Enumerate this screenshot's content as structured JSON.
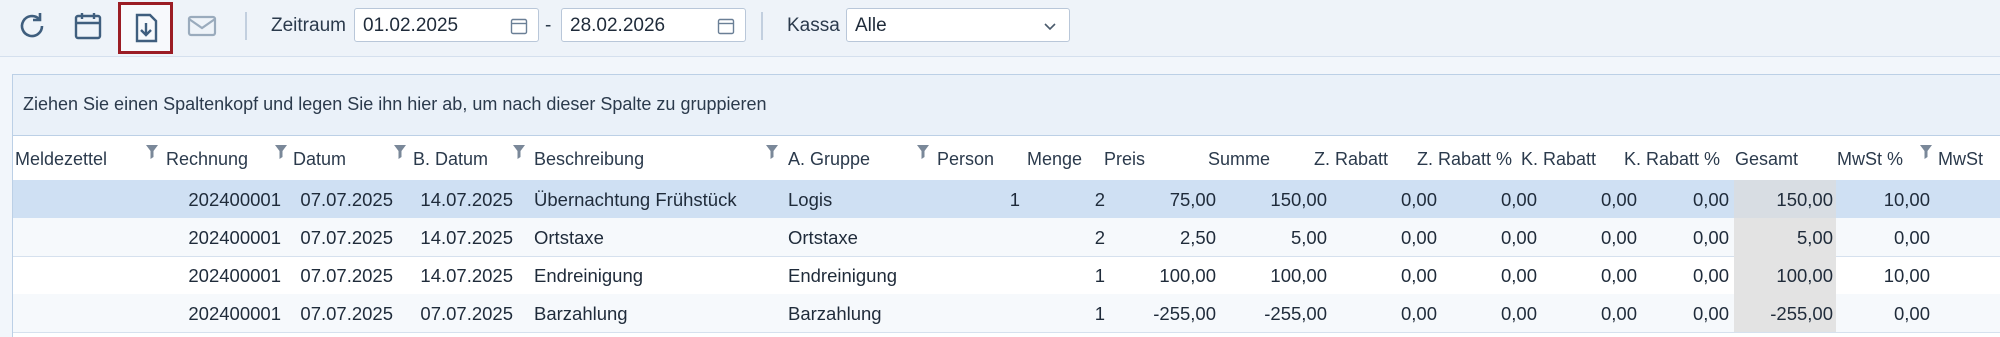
{
  "toolbar": {
    "zeitraum_label": "Zeitraum",
    "date_from": "01.02.2025",
    "date_sep": "-",
    "date_to": "28.02.2026",
    "kassa_label": "Kassa",
    "kassa_value": "Alle",
    "active_button": "export-icon",
    "highlight_color": "#9b1c24"
  },
  "group_panel": {
    "text": "Ziehen Sie einen Spaltenkopf und legen Sie ihn hier ab, um nach dieser Spalte zu gruppieren"
  },
  "grid": {
    "columns": [
      "Meldezettel",
      "Rechnung",
      "Datum",
      "B. Datum",
      "Beschreibung",
      "A. Gruppe",
      "Person",
      "Menge",
      "Preis",
      "Summe",
      "Z. Rabatt",
      "Z. Rabatt %",
      "K. Rabatt",
      "K. Rabatt %",
      "Gesamt",
      "MwSt %",
      "MwSt"
    ],
    "rows": [
      {
        "meldezettel": "",
        "rechnung": "202400001",
        "datum": "07.07.2025",
        "bdatum": "14.07.2025",
        "beschreibung": "Übernachtung Frühstück",
        "agruppe": "Logis",
        "person": "1",
        "menge": "2",
        "preis": "75,00",
        "summe": "150,00",
        "zrabatt": "0,00",
        "zrabattp": "0,00",
        "krabatt": "0,00",
        "krabattp": "0,00",
        "gesamt": "150,00",
        "mwstp": "10,00"
      },
      {
        "meldezettel": "",
        "rechnung": "202400001",
        "datum": "07.07.2025",
        "bdatum": "14.07.2025",
        "beschreibung": "Ortstaxe",
        "agruppe": "Ortstaxe",
        "person": "",
        "menge": "2",
        "preis": "2,50",
        "summe": "5,00",
        "zrabatt": "0,00",
        "zrabattp": "0,00",
        "krabatt": "0,00",
        "krabattp": "0,00",
        "gesamt": "5,00",
        "mwstp": "0,00"
      },
      {
        "meldezettel": "",
        "rechnung": "202400001",
        "datum": "07.07.2025",
        "bdatum": "14.07.2025",
        "beschreibung": "Endreinigung",
        "agruppe": "Endreinigung",
        "person": "",
        "menge": "1",
        "preis": "100,00",
        "summe": "100,00",
        "zrabatt": "0,00",
        "zrabattp": "0,00",
        "krabatt": "0,00",
        "krabattp": "0,00",
        "gesamt": "100,00",
        "mwstp": "10,00"
      },
      {
        "meldezettel": "",
        "rechnung": "202400001",
        "datum": "07.07.2025",
        "bdatum": "07.07.2025",
        "beschreibung": "Barzahlung",
        "agruppe": "Barzahlung",
        "person": "",
        "menge": "1",
        "preis": "-255,00",
        "summe": "-255,00",
        "zrabatt": "0,00",
        "zrabattp": "0,00",
        "krabatt": "0,00",
        "krabattp": "0,00",
        "gesamt": "-255,00",
        "mwstp": "0,00"
      }
    ]
  }
}
